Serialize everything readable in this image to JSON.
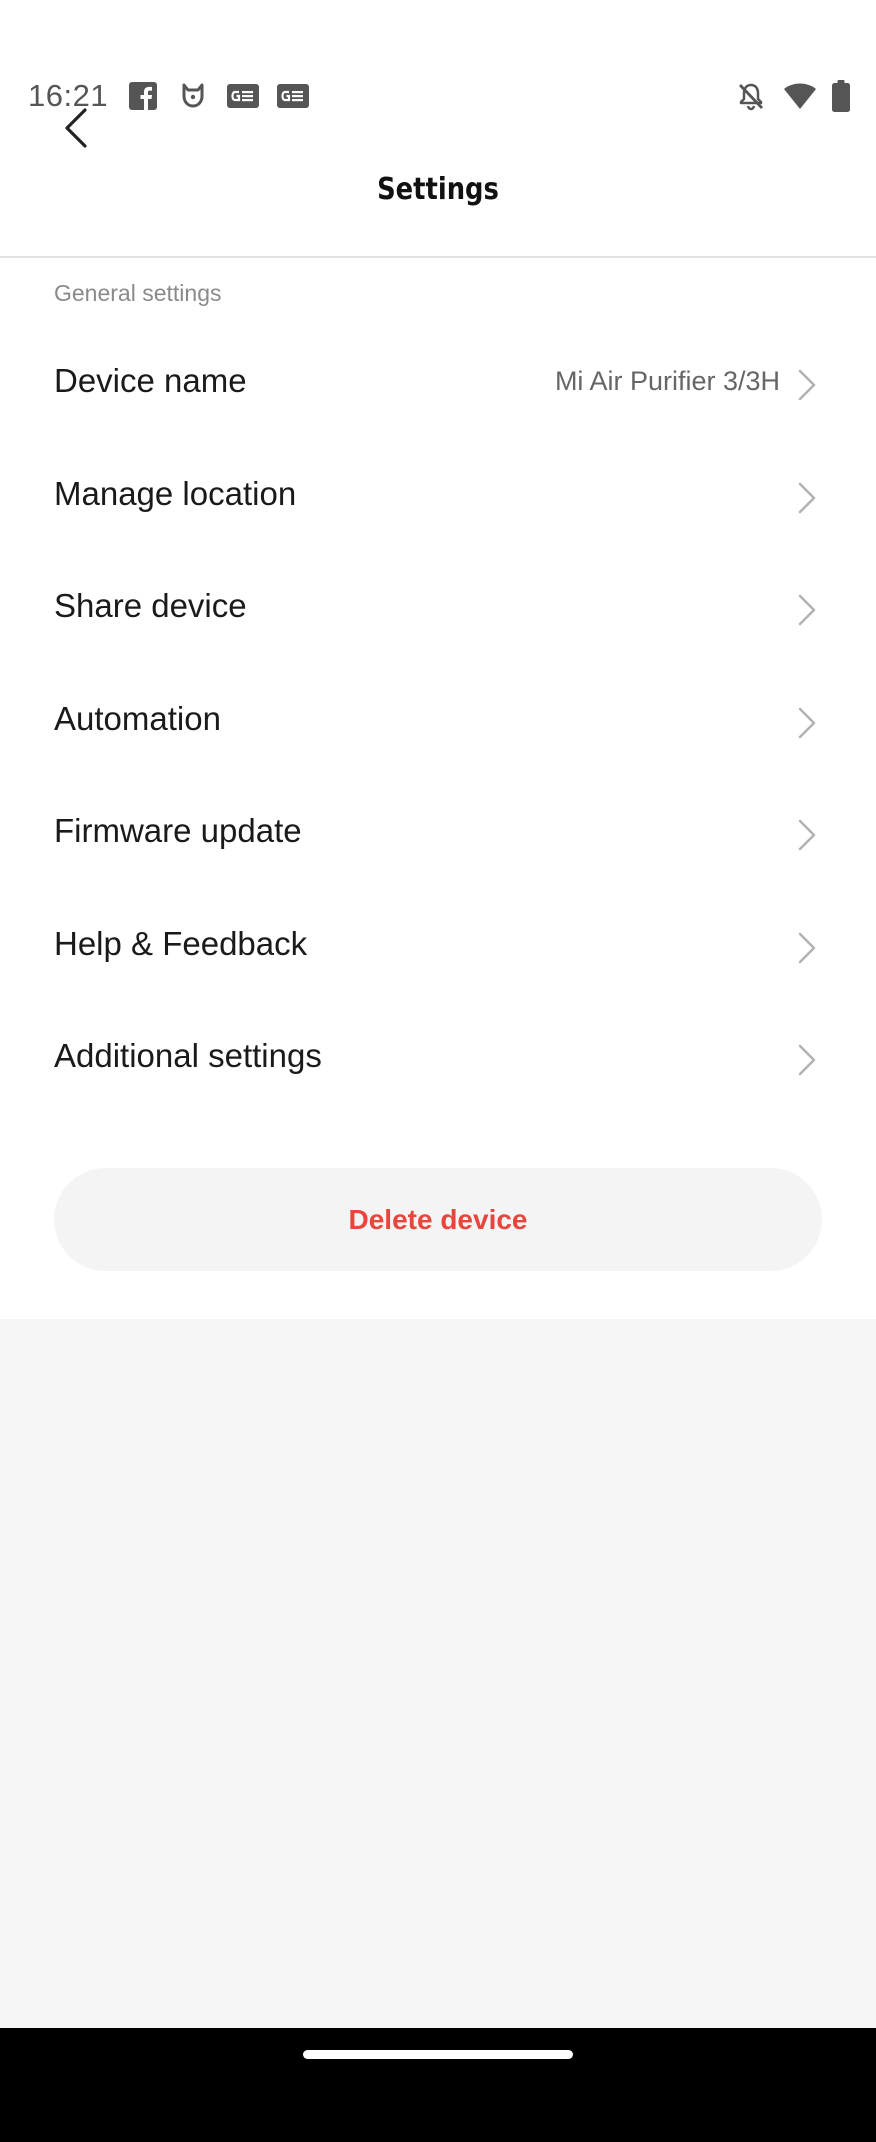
{
  "status_bar": {
    "time": "16:21",
    "left_icons": [
      "facebook-icon",
      "mi-home-icon",
      "gmail-news-icon",
      "gmail-news-icon"
    ],
    "right_icons": [
      "notifications-off-icon",
      "wifi-icon",
      "battery-icon"
    ]
  },
  "header": {
    "title": "Settings",
    "back_icon": "chevron-left-icon"
  },
  "section": {
    "label": "General settings"
  },
  "items": [
    {
      "label": "Device name",
      "value": "Mi Air Purifier 3/3H"
    },
    {
      "label": "Manage location",
      "value": ""
    },
    {
      "label": "Share device",
      "value": ""
    },
    {
      "label": "Automation",
      "value": ""
    },
    {
      "label": "Firmware update",
      "value": ""
    },
    {
      "label": "Help & Feedback",
      "value": ""
    },
    {
      "label": "Additional settings",
      "value": ""
    }
  ],
  "delete_button": {
    "label": "Delete device",
    "color": "#e8453c"
  },
  "colors": {
    "background": "#f5f5f5",
    "surface": "#ffffff",
    "danger": "#e8453c"
  }
}
